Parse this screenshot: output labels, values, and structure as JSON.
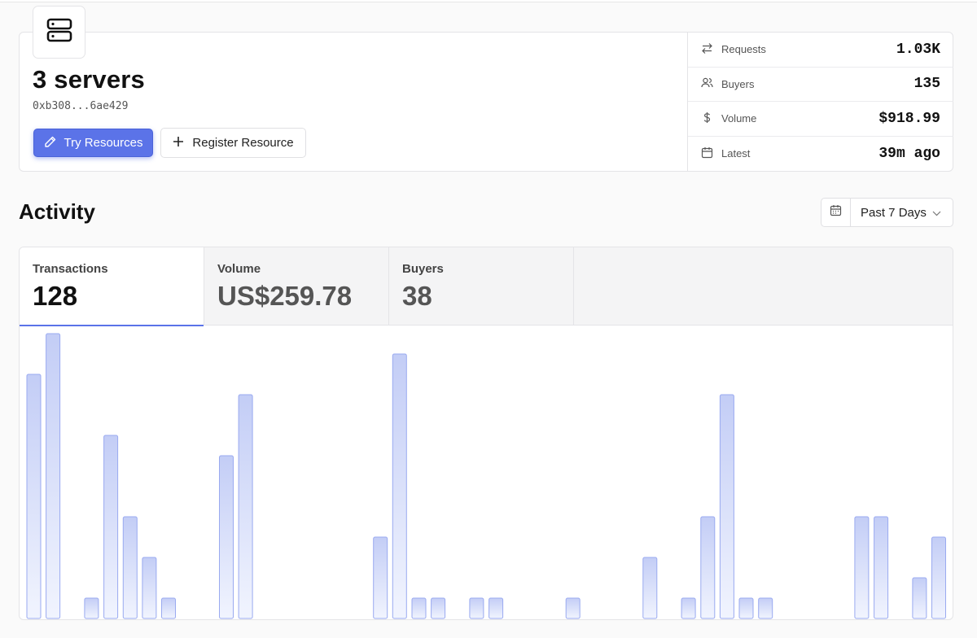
{
  "header": {
    "title": "3 servers",
    "address": "0xb308...6ae429",
    "primary_button": "Try Resources",
    "secondary_button": "Register Resource",
    "stats": [
      {
        "icon": "arrows-exchange-icon",
        "label": "Requests",
        "value": "1.03K"
      },
      {
        "icon": "users-icon",
        "label": "Buyers",
        "value": "135"
      },
      {
        "icon": "dollar-icon",
        "label": "Volume",
        "value": "$918.99"
      },
      {
        "icon": "calendar-icon",
        "label": "Latest",
        "value": "39m ago"
      }
    ]
  },
  "activity": {
    "title": "Activity",
    "range": "Past 7 Days",
    "tabs": [
      {
        "label": "Transactions",
        "value": "128",
        "active": true
      },
      {
        "label": "Volume",
        "value": "US$259.78",
        "active": false
      },
      {
        "label": "Buyers",
        "value": "38",
        "active": false
      }
    ]
  },
  "colors": {
    "accent": "#5b73e8",
    "bar_top": "#c3cdf6",
    "bar_bottom": "#f1f4fe",
    "bar_stroke": "#9aaaf0"
  },
  "chart_data": {
    "type": "bar",
    "title": "",
    "xlabel": "",
    "ylabel": "",
    "ylim": [
      0,
      14
    ],
    "grid": false,
    "values": [
      12,
      14,
      0,
      1,
      9,
      5,
      3,
      1,
      0,
      0,
      8,
      11,
      0,
      0,
      0,
      0,
      0,
      0,
      4,
      13,
      1,
      1,
      0,
      1,
      1,
      0,
      0,
      0,
      1,
      0,
      0,
      0,
      3,
      0,
      1,
      5,
      11,
      1,
      1,
      0,
      0,
      0,
      0,
      5,
      5,
      0,
      2,
      4
    ]
  }
}
